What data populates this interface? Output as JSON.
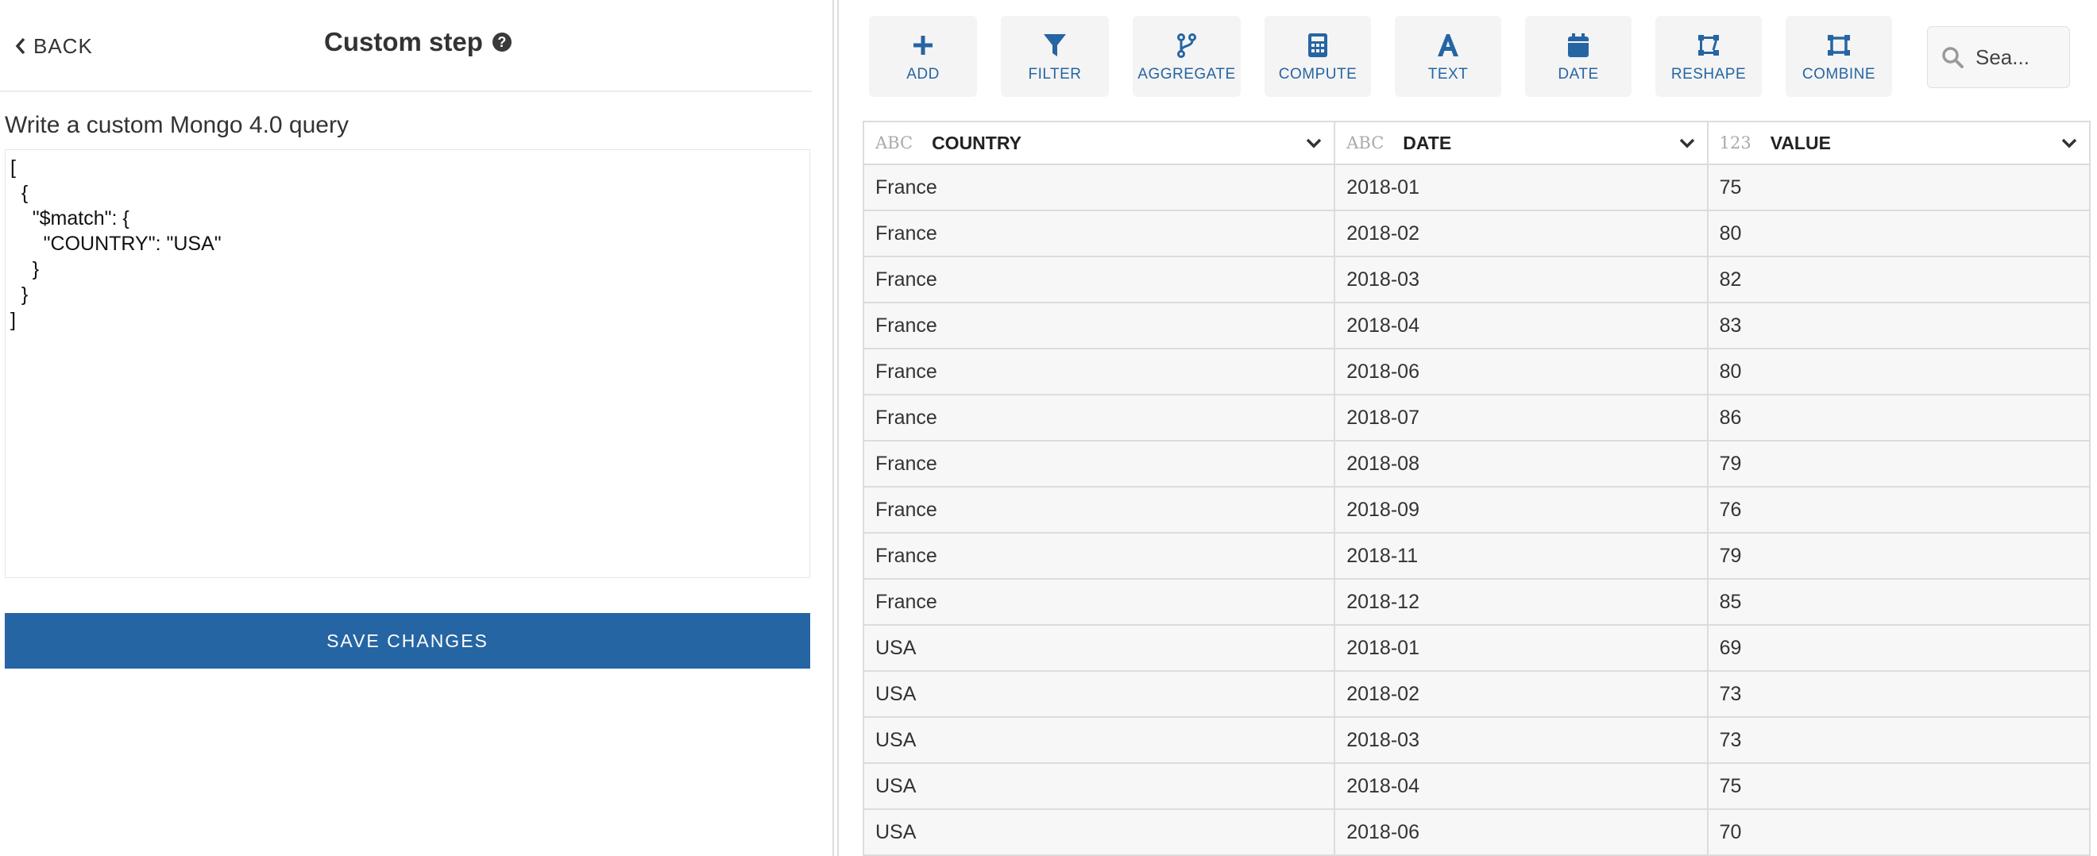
{
  "step_panel": {
    "back_label": "BACK",
    "title": "Custom step",
    "query_label": "Write a custom Mongo 4.0 query",
    "query_value": "[\n  {\n    \"$match\": {\n      \"COUNTRY\": \"USA\"\n    }\n  }\n]",
    "save_label": "SAVE CHANGES"
  },
  "toolbar": {
    "buttons": [
      {
        "label": "ADD",
        "icon": "plus-icon"
      },
      {
        "label": "FILTER",
        "icon": "filter-icon"
      },
      {
        "label": "AGGREGATE",
        "icon": "branch-icon"
      },
      {
        "label": "COMPUTE",
        "icon": "calculator-icon"
      },
      {
        "label": "TEXT",
        "icon": "letter-a-icon"
      },
      {
        "label": "DATE",
        "icon": "calendar-icon"
      },
      {
        "label": "RESHAPE",
        "icon": "reshape-icon"
      },
      {
        "label": "COMBINE",
        "icon": "combine-icon"
      }
    ],
    "search_placeholder": "Sea..."
  },
  "table": {
    "columns": [
      {
        "type": "ABC",
        "name": "COUNTRY"
      },
      {
        "type": "ABC",
        "name": "DATE"
      },
      {
        "type": "123",
        "name": "VALUE"
      }
    ],
    "rows": [
      [
        "France",
        "2018-01",
        "75"
      ],
      [
        "France",
        "2018-02",
        "80"
      ],
      [
        "France",
        "2018-03",
        "82"
      ],
      [
        "France",
        "2018-04",
        "83"
      ],
      [
        "France",
        "2018-06",
        "80"
      ],
      [
        "France",
        "2018-07",
        "86"
      ],
      [
        "France",
        "2018-08",
        "79"
      ],
      [
        "France",
        "2018-09",
        "76"
      ],
      [
        "France",
        "2018-11",
        "79"
      ],
      [
        "France",
        "2018-12",
        "85"
      ],
      [
        "USA",
        "2018-01",
        "69"
      ],
      [
        "USA",
        "2018-02",
        "73"
      ],
      [
        "USA",
        "2018-03",
        "73"
      ],
      [
        "USA",
        "2018-04",
        "75"
      ],
      [
        "USA",
        "2018-06",
        "70"
      ]
    ]
  },
  "colors": {
    "accent": "#2665a3",
    "tool_bg": "#f4f4f4",
    "row_bg": "#f7f7f7"
  }
}
